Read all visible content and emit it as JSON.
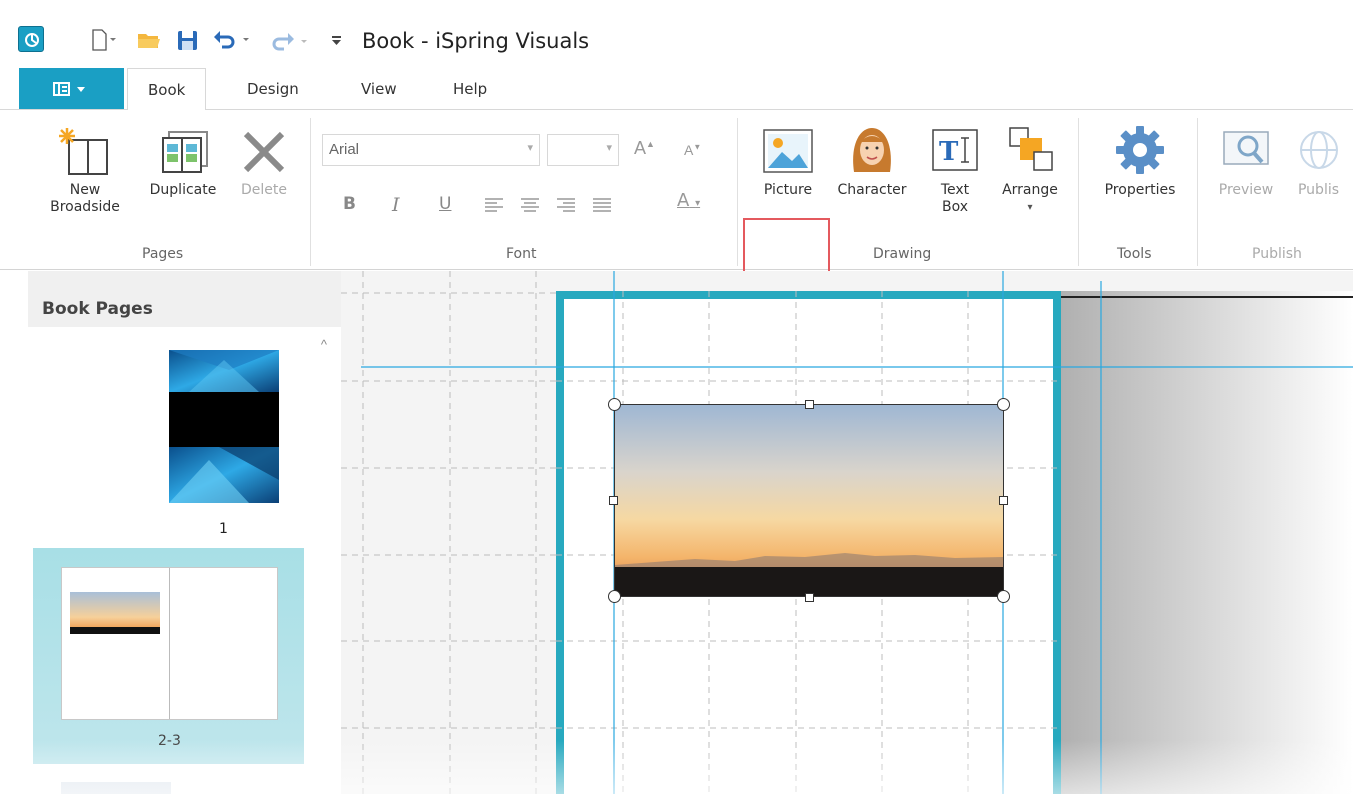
{
  "window": {
    "title": "Book - iSpring Visuals"
  },
  "tabs": {
    "file_menu_icon": "menu-list-icon",
    "items": [
      {
        "label": "Book",
        "active": true
      },
      {
        "label": "Design",
        "active": false
      },
      {
        "label": "View",
        "active": false
      },
      {
        "label": "Help",
        "active": false
      }
    ]
  },
  "ribbon": {
    "pages_group": {
      "label": "Pages",
      "new_broadside_line1": "New",
      "new_broadside_line2": "Broadside",
      "duplicate": "Duplicate",
      "delete": "Delete"
    },
    "font_group": {
      "label": "Font",
      "font_name": "Arial",
      "font_size": "",
      "bold": "B",
      "italic": "I",
      "underline": "U",
      "font_color": "A"
    },
    "drawing_group": {
      "label": "Drawing",
      "picture": "Picture",
      "character": "Character",
      "text_box_line1": "Text",
      "text_box_line2": "Box",
      "arrange": "Arrange"
    },
    "tools_group": {
      "label": "Tools",
      "properties": "Properties"
    },
    "publish_group": {
      "label": "Publish",
      "preview": "Preview",
      "publish": "Publis"
    }
  },
  "left_panel": {
    "title": "Book Pages",
    "thumbnails": [
      {
        "label": "1",
        "selected": false
      },
      {
        "label": "2-3",
        "selected": true
      }
    ]
  },
  "colors": {
    "accent": "#1a9fc4",
    "page_border": "#27a9bf",
    "highlight": "#e4595e",
    "guide": "#29a8e0"
  }
}
